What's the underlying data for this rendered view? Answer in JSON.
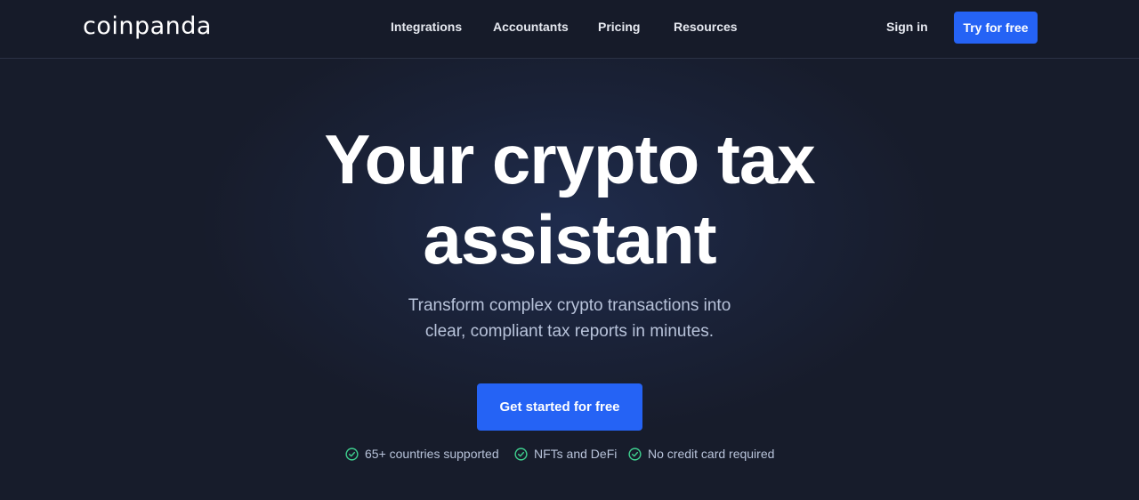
{
  "header": {
    "logo": "coinpanda",
    "nav": [
      {
        "label": "Integrations"
      },
      {
        "label": "Accountants"
      },
      {
        "label": "Pricing"
      },
      {
        "label": "Resources"
      }
    ],
    "signin_label": "Sign in",
    "try_label": "Try for free"
  },
  "hero": {
    "title_line1": "Your crypto tax",
    "title_line2": "assistant",
    "subtitle_line1": "Transform complex crypto transactions into",
    "subtitle_line2": "clear, compliant tax reports in minutes.",
    "cta_label": "Get started for free"
  },
  "features": [
    {
      "label": "65+ countries supported",
      "icon": "check-circle-icon"
    },
    {
      "label": "NFTs and DeFi",
      "icon": "check-circle-icon"
    },
    {
      "label": "No credit card required",
      "icon": "check-circle-icon"
    }
  ],
  "colors": {
    "background": "#171c2b",
    "accent": "#2563f5",
    "check": "#3ecf8e",
    "subtitle": "#b8c3da"
  }
}
